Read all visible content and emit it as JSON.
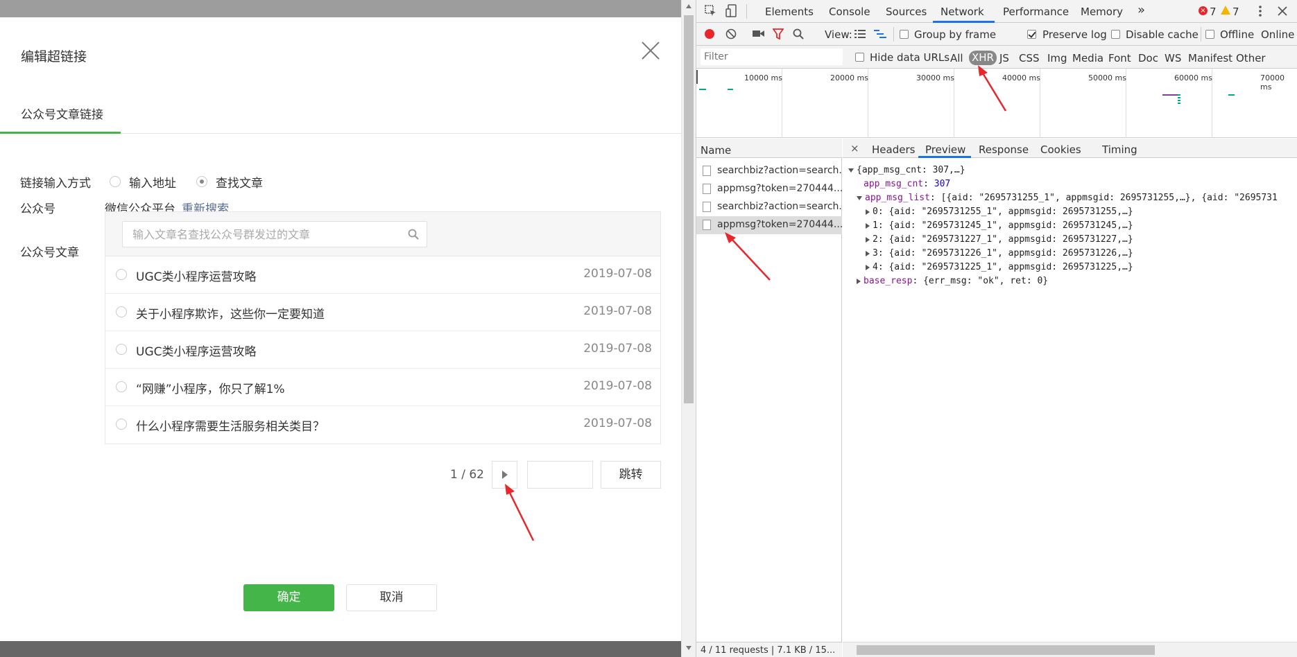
{
  "dialog": {
    "title": "编辑超链接",
    "tab": "公众号文章链接",
    "input_mode_label": "链接输入方式",
    "radio_url": "输入地址",
    "radio_search": "查找文章",
    "account_label": "公众号",
    "account_name": "微信公众平台",
    "research_link": "重新搜索",
    "articles_label": "公众号文章",
    "search_placeholder": "输入文章名查找公众号群发过的文章",
    "articles": [
      {
        "title": "UGC类小程序运营攻略",
        "date": "2019-07-08"
      },
      {
        "title": "关于小程序欺诈，这些你一定要知道",
        "date": "2019-07-08"
      },
      {
        "title": "UGC类小程序运营攻略",
        "date": "2019-07-08"
      },
      {
        "title": "“网赚”小程序，你只了解1%",
        "date": "2019-07-08"
      },
      {
        "title": "什么小程序需要生活服务相关类目？",
        "date": "2019-07-08"
      }
    ],
    "pager": "1 / 62",
    "jump": "跳转",
    "ok": "确定",
    "cancel": "取消"
  },
  "devtools": {
    "tabs": [
      "Elements",
      "Console",
      "Sources",
      "Network",
      "Performance",
      "Memory"
    ],
    "more": "»",
    "errors": "7",
    "warnings": "7",
    "toolbar": {
      "view": "View:",
      "group_by_frame": "Group by frame",
      "preserve_log": "Preserve log",
      "disable_cache": "Disable cache",
      "offline": "Offline",
      "online": "Online"
    },
    "filter": {
      "placeholder": "Filter",
      "hide_data_urls": "Hide data URLs",
      "types": [
        "All",
        "XHR",
        "JS",
        "CSS",
        "Img",
        "Media",
        "Font",
        "Doc",
        "WS",
        "Manifest",
        "Other"
      ],
      "selected": "XHR"
    },
    "timeline_labels": [
      "10000 ms",
      "20000 ms",
      "30000 ms",
      "40000 ms",
      "50000 ms",
      "60000 ms",
      "70000 ms"
    ],
    "name_header": "Name",
    "requests": [
      "searchbiz?action=search...",
      "appmsg?token=270444...",
      "searchbiz?action=search...",
      "appmsg?token=270444..."
    ],
    "footer": "4 / 11 requests  |  7.1 KB / 15...",
    "detail_tabs": [
      "Headers",
      "Preview",
      "Response",
      "Cookies",
      "Timing"
    ],
    "close": "×",
    "preview": {
      "root": "{app_msg_cnt: 307,…}",
      "cnt_key": "app_msg_cnt",
      "cnt_val": "307",
      "list_key": "app_msg_list",
      "list_summary": "[{aid: \"2695731255_1\", appmsgid: 2695731255,…}, {aid: \"2695731",
      "items": [
        "0: {aid: \"2695731255_1\", appmsgid: 2695731255,…}",
        "1: {aid: \"2695731245_1\", appmsgid: 2695731245,…}",
        "2: {aid: \"2695731227_1\", appmsgid: 2695731227,…}",
        "3: {aid: \"2695731226_1\", appmsgid: 2695731226,…}",
        "4: {aid: \"2695731225_1\", appmsgid: 2695731225,…}"
      ],
      "base_key": "base_resp",
      "base_val": "{err_msg: \"ok\", ret: 0}"
    }
  },
  "colors": {
    "accent_green": "#44b549",
    "link_blue": "#576b95",
    "annotation_red": "#e8262b",
    "devtools_blue": "#1a73e8"
  }
}
